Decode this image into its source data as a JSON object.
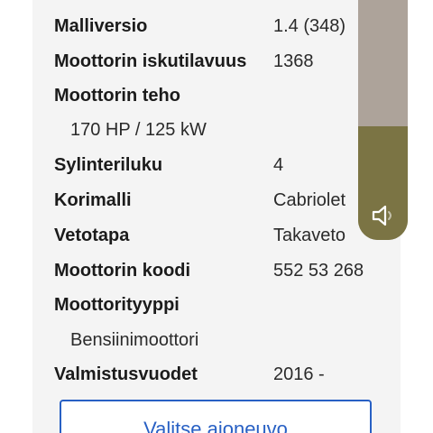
{
  "specs": {
    "malliversio": {
      "label": "Malliversio",
      "value": "1.4 (348)"
    },
    "iskutilavuus": {
      "label": "Moottorin iskutilavuus",
      "value": "1368"
    },
    "teho": {
      "label": "Moottorin teho",
      "value": "170 HP / 125 kW"
    },
    "sylinteriluku": {
      "label": "Sylinteriluku",
      "value": "4"
    },
    "korimalli": {
      "label": "Korimalli",
      "value": "Cabriolet"
    },
    "vetotapa": {
      "label": "Vetotapa",
      "value": "Takaveto"
    },
    "koodi": {
      "label": "Moottorin koodi",
      "value": "552 53 268"
    },
    "moottorityyppi": {
      "label": "Moottorityyppi",
      "value": "Bensiinimoottori"
    },
    "valmistusvuodet": {
      "label": "Valmistusvuodet",
      "value": "2016 -"
    }
  },
  "actions": {
    "select_vehicle": "Valitse ajoneuvo"
  },
  "video": {
    "mute_icon": "speaker-muted-icon",
    "colors": {
      "top": "#ada39a",
      "bottom": "#7b7444"
    }
  },
  "colors": {
    "accent": "#2860c4",
    "card_background": "#f4f4f4"
  }
}
